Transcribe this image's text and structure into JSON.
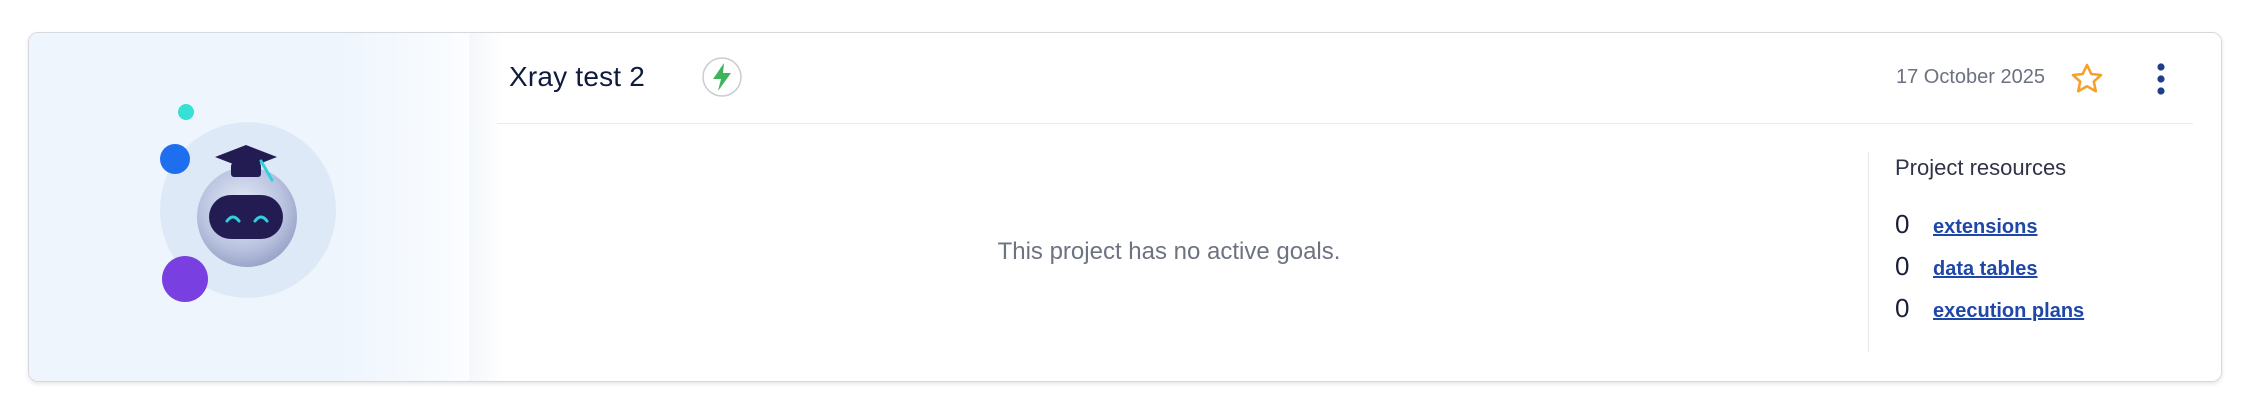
{
  "project": {
    "title": "Xray test 2",
    "date": "17 October 2025",
    "empty_message": "This project has no active goals."
  },
  "icons": {
    "status": "lightning-bolt-icon",
    "favorite": "star-outline-icon",
    "menu": "vertical-dots-icon",
    "thumbnail": "robot-graduate-illustration"
  },
  "resources": {
    "title": "Project resources",
    "items": [
      {
        "count": "0",
        "label": "extensions"
      },
      {
        "count": "0",
        "label": "data tables"
      },
      {
        "count": "0",
        "label": "execution plans"
      }
    ]
  },
  "colors": {
    "link": "#1f47a8",
    "star": "#f5a028",
    "bolt": "#3fb45c",
    "menu_dots": "#1f3f8a"
  }
}
